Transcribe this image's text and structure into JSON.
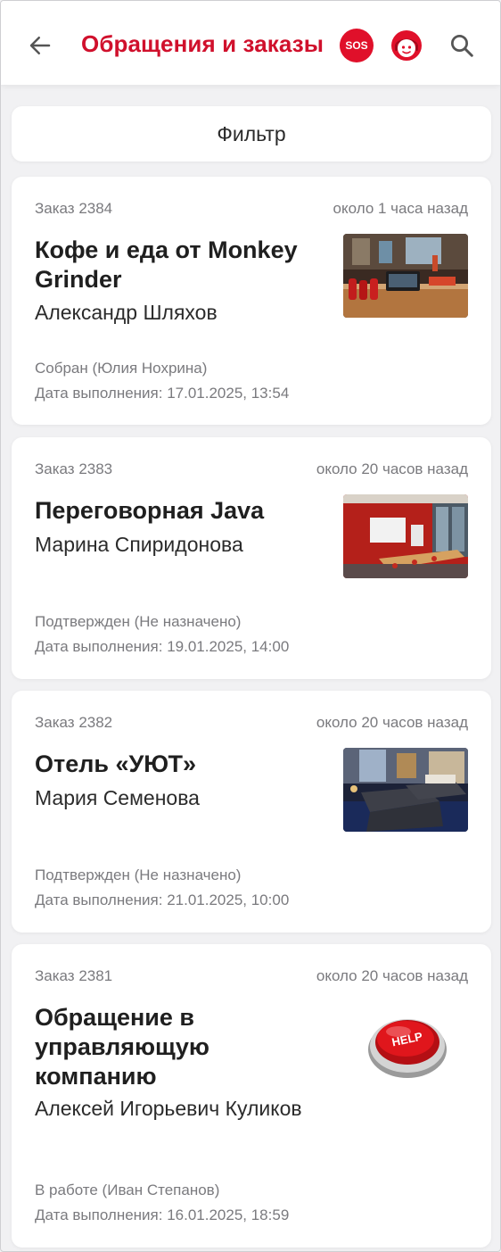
{
  "header": {
    "title": "Обращения и заказы",
    "sos_label": "SOS",
    "accent": "#d0102c"
  },
  "filter": {
    "label": "Фильтр"
  },
  "orders": [
    {
      "number": "Заказ 2384",
      "time_ago": "около 1 часа назад",
      "title": "Кофе и еда от Monkey Grinder",
      "person": "Александр Шляхов",
      "status": "Собран (Юлия Нохрина)",
      "due": "Дата выполнения: 17.01.2025, 13:54",
      "image": "cafe-photo"
    },
    {
      "number": "Заказ 2383",
      "time_ago": "около 20 часов назад",
      "title": "Переговорная Java",
      "person": "Марина Спиридонова",
      "status": "Подтвержден (Не назначено)",
      "due": "Дата выполнения: 19.01.2025, 14:00",
      "image": "meeting-room-photo"
    },
    {
      "number": "Заказ 2382",
      "time_ago": "около 20 часов назад",
      "title": "Отель «УЮТ»",
      "person": "Мария Семенова",
      "status": "Подтвержден (Не назначено)",
      "due": "Дата выполнения: 21.01.2025, 10:00",
      "image": "hotel-room-photo"
    },
    {
      "number": "Заказ 2381",
      "time_ago": "около 20 часов назад",
      "title": "Обращение в управляющую компанию",
      "person": "Алексей Игорьевич Куликов",
      "status": "В работе (Иван Степанов)",
      "due": "Дата выполнения: 16.01.2025, 18:59",
      "image": "help-button-picture",
      "image_text": "HELP"
    }
  ]
}
